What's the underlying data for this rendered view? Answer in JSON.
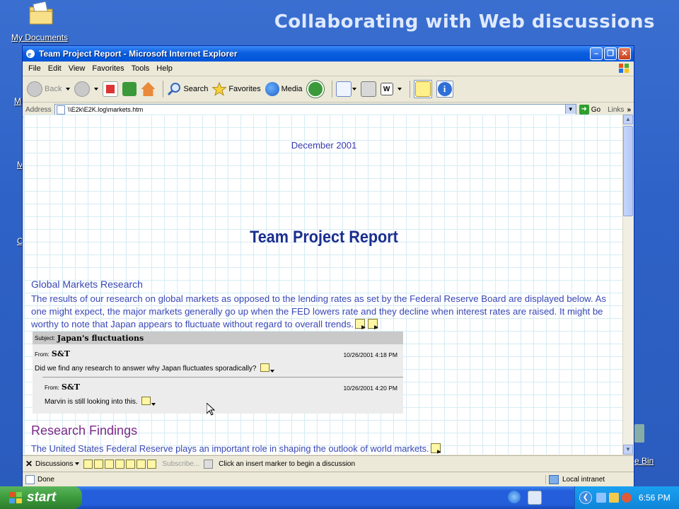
{
  "slide_title": "Collaborating with Web discussions",
  "desktop": {
    "my_documents": "My Documents",
    "frag_1": "M",
    "frag_2": "M",
    "frag_3": "C",
    "recycle_frag": "e Bin"
  },
  "window": {
    "title": "Team Project Report - Microsoft Internet Explorer",
    "menu": [
      "File",
      "Edit",
      "View",
      "Favorites",
      "Tools",
      "Help"
    ],
    "toolbar": {
      "back": "Back",
      "search": "Search",
      "favorites": "Favorites",
      "media": "Media"
    },
    "address": {
      "label": "Address",
      "url": "\\\\E2k\\E2K.log\\markets.htm",
      "go": "Go",
      "links": "Links"
    }
  },
  "document": {
    "date": "December 2001",
    "title": "Team Project Report",
    "section1_heading": "Global Markets Research",
    "section1_body": "The results of our research on global markets as opposed to the lending rates as set by the Federal Reserve Board are displayed below. As one might expect, the major markets generally go up when the FED lowers rate and they decline when interest rates are raised. It might be worthy to note that Japan appears to fluctuate without regard to overall trends.",
    "section2_heading": "Research Findings",
    "section2_body": "The United States Federal Reserve plays an important role in shaping the outlook of world markets."
  },
  "discussion": {
    "subject_label": "Subject:",
    "subject": "Japan's fluctuations",
    "entries": [
      {
        "from_label": "From:",
        "author": "S&T",
        "date": "10/26/2001 4:18 PM",
        "message": "Did we find any research to answer why Japan fluctuates sporadically?"
      },
      {
        "from_label": "From:",
        "author": "S&T",
        "date": "10/26/2001 4:20 PM",
        "message": "Marvin is still looking into this."
      }
    ]
  },
  "discussions_bar": {
    "close": "✕",
    "discussions": "Discussions",
    "subscribe": "Subscribe...",
    "hint": "Click an insert marker to begin a discussion"
  },
  "status": {
    "left": "Done",
    "zone": "Local intranet"
  },
  "taskbar": {
    "start": "start",
    "clock": "6:56 PM"
  },
  "colors": {
    "accent_blue": "#3947b5",
    "title_navy": "#1b2f8f",
    "findings_purple": "#7a2a86"
  }
}
